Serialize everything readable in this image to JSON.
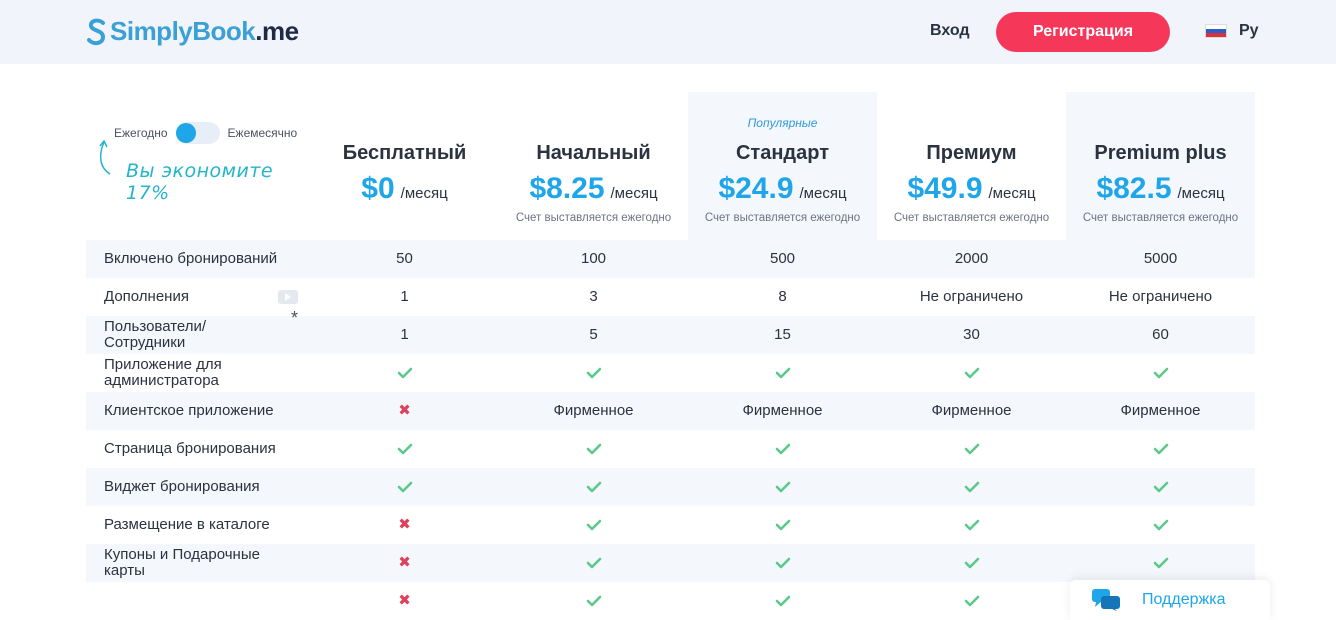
{
  "header": {
    "logo_part1": "SimplyBook",
    "logo_part2": ".me",
    "login": "Вход",
    "signup": "Регистрация",
    "language": "Ру"
  },
  "billing": {
    "yearly": "Ежегодно",
    "monthly": "Ежемесячно",
    "save": "Вы экономите 17%"
  },
  "plans": [
    {
      "name": "Бесплатный",
      "popular": "",
      "price": "$0",
      "unit": "/месяц",
      "billing": ""
    },
    {
      "name": "Начальный",
      "popular": "",
      "price": "$8.25",
      "unit": "/месяц",
      "billing": "Счет выставляется ежегодно"
    },
    {
      "name": "Стандарт",
      "popular": "Популярные",
      "price": "$24.9",
      "unit": "/месяц",
      "billing": "Счет выставляется ежегодно"
    },
    {
      "name": "Премиум",
      "popular": "",
      "price": "$49.9",
      "unit": "/месяц",
      "billing": "Счет выставляется ежегодно"
    },
    {
      "name": "Premium plus",
      "popular": "",
      "price": "$82.5",
      "unit": "/месяц",
      "billing": "Счет выставляется ежегодно"
    }
  ],
  "features": [
    {
      "label": "Включено бронирований",
      "extra": "",
      "values": [
        "50",
        "100",
        "500",
        "2000",
        "5000"
      ]
    },
    {
      "label": "Дополнения",
      "extra": "video",
      "values": [
        "1",
        "3",
        "8",
        "Не ограничено",
        "Не ограничено"
      ]
    },
    {
      "label": "Пользователи/ Сотрудники",
      "extra": "*",
      "values": [
        "1",
        "5",
        "15",
        "30",
        "60"
      ]
    },
    {
      "label": "Приложение для администратора",
      "extra": "",
      "values": [
        "check",
        "check",
        "check",
        "check",
        "check"
      ]
    },
    {
      "label": "Клиентское приложение",
      "extra": "",
      "values": [
        "cross",
        "Фирменное",
        "Фирменное",
        "Фирменное",
        "Фирменное"
      ]
    },
    {
      "label": "Страница бронирования",
      "extra": "",
      "values": [
        "check",
        "check",
        "check",
        "check",
        "check"
      ]
    },
    {
      "label": "Виджет бронирования",
      "extra": "",
      "values": [
        "check",
        "check",
        "check",
        "check",
        "check"
      ]
    },
    {
      "label": "Размещение в каталоге",
      "extra": "",
      "values": [
        "cross",
        "check",
        "check",
        "check",
        "check"
      ]
    },
    {
      "label": "Купоны и Подарочные карты",
      "extra": "",
      "values": [
        "cross",
        "check",
        "check",
        "check",
        "check"
      ]
    },
    {
      "label": "",
      "extra": "",
      "values": [
        "cross",
        "check",
        "check",
        "check",
        "check"
      ]
    }
  ],
  "support": {
    "label": "Поддержка"
  },
  "colors": {
    "accent": "#1ea6e8",
    "signup": "#f5385a",
    "check": "#5cc98a",
    "cross": "#e0405b"
  },
  "icons": {
    "check": "check-icon",
    "cross": "cross-icon",
    "video": "video-icon",
    "support": "chat-bubbles-icon",
    "flag": "russia-flag-icon"
  }
}
